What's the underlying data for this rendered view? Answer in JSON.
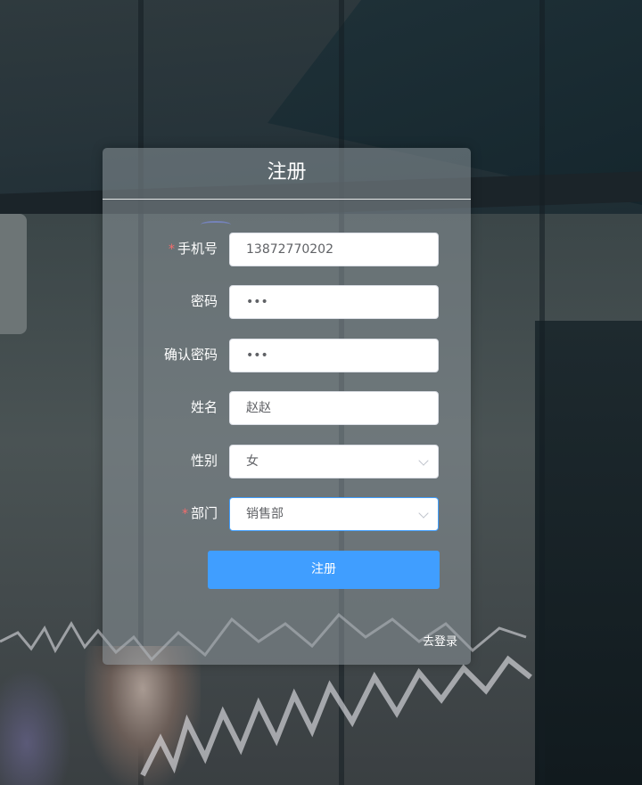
{
  "form": {
    "title": "注册",
    "fields": [
      {
        "label": "手机号",
        "required": true,
        "value": "13872770202",
        "type": "text"
      },
      {
        "label": "密码",
        "required": false,
        "value": "•••",
        "type": "password"
      },
      {
        "label": "确认密码",
        "required": false,
        "value": "•••",
        "type": "password"
      },
      {
        "label": "姓名",
        "required": false,
        "value": "赵赵",
        "type": "text"
      },
      {
        "label": "性别",
        "required": false,
        "value": "女",
        "type": "select"
      },
      {
        "label": "部门",
        "required": true,
        "value": "销售部",
        "type": "select"
      }
    ],
    "submit_label": "注册",
    "login_link": "去登录"
  },
  "colors": {
    "primary": "#409eff",
    "required_mark": "#f56c6c"
  }
}
